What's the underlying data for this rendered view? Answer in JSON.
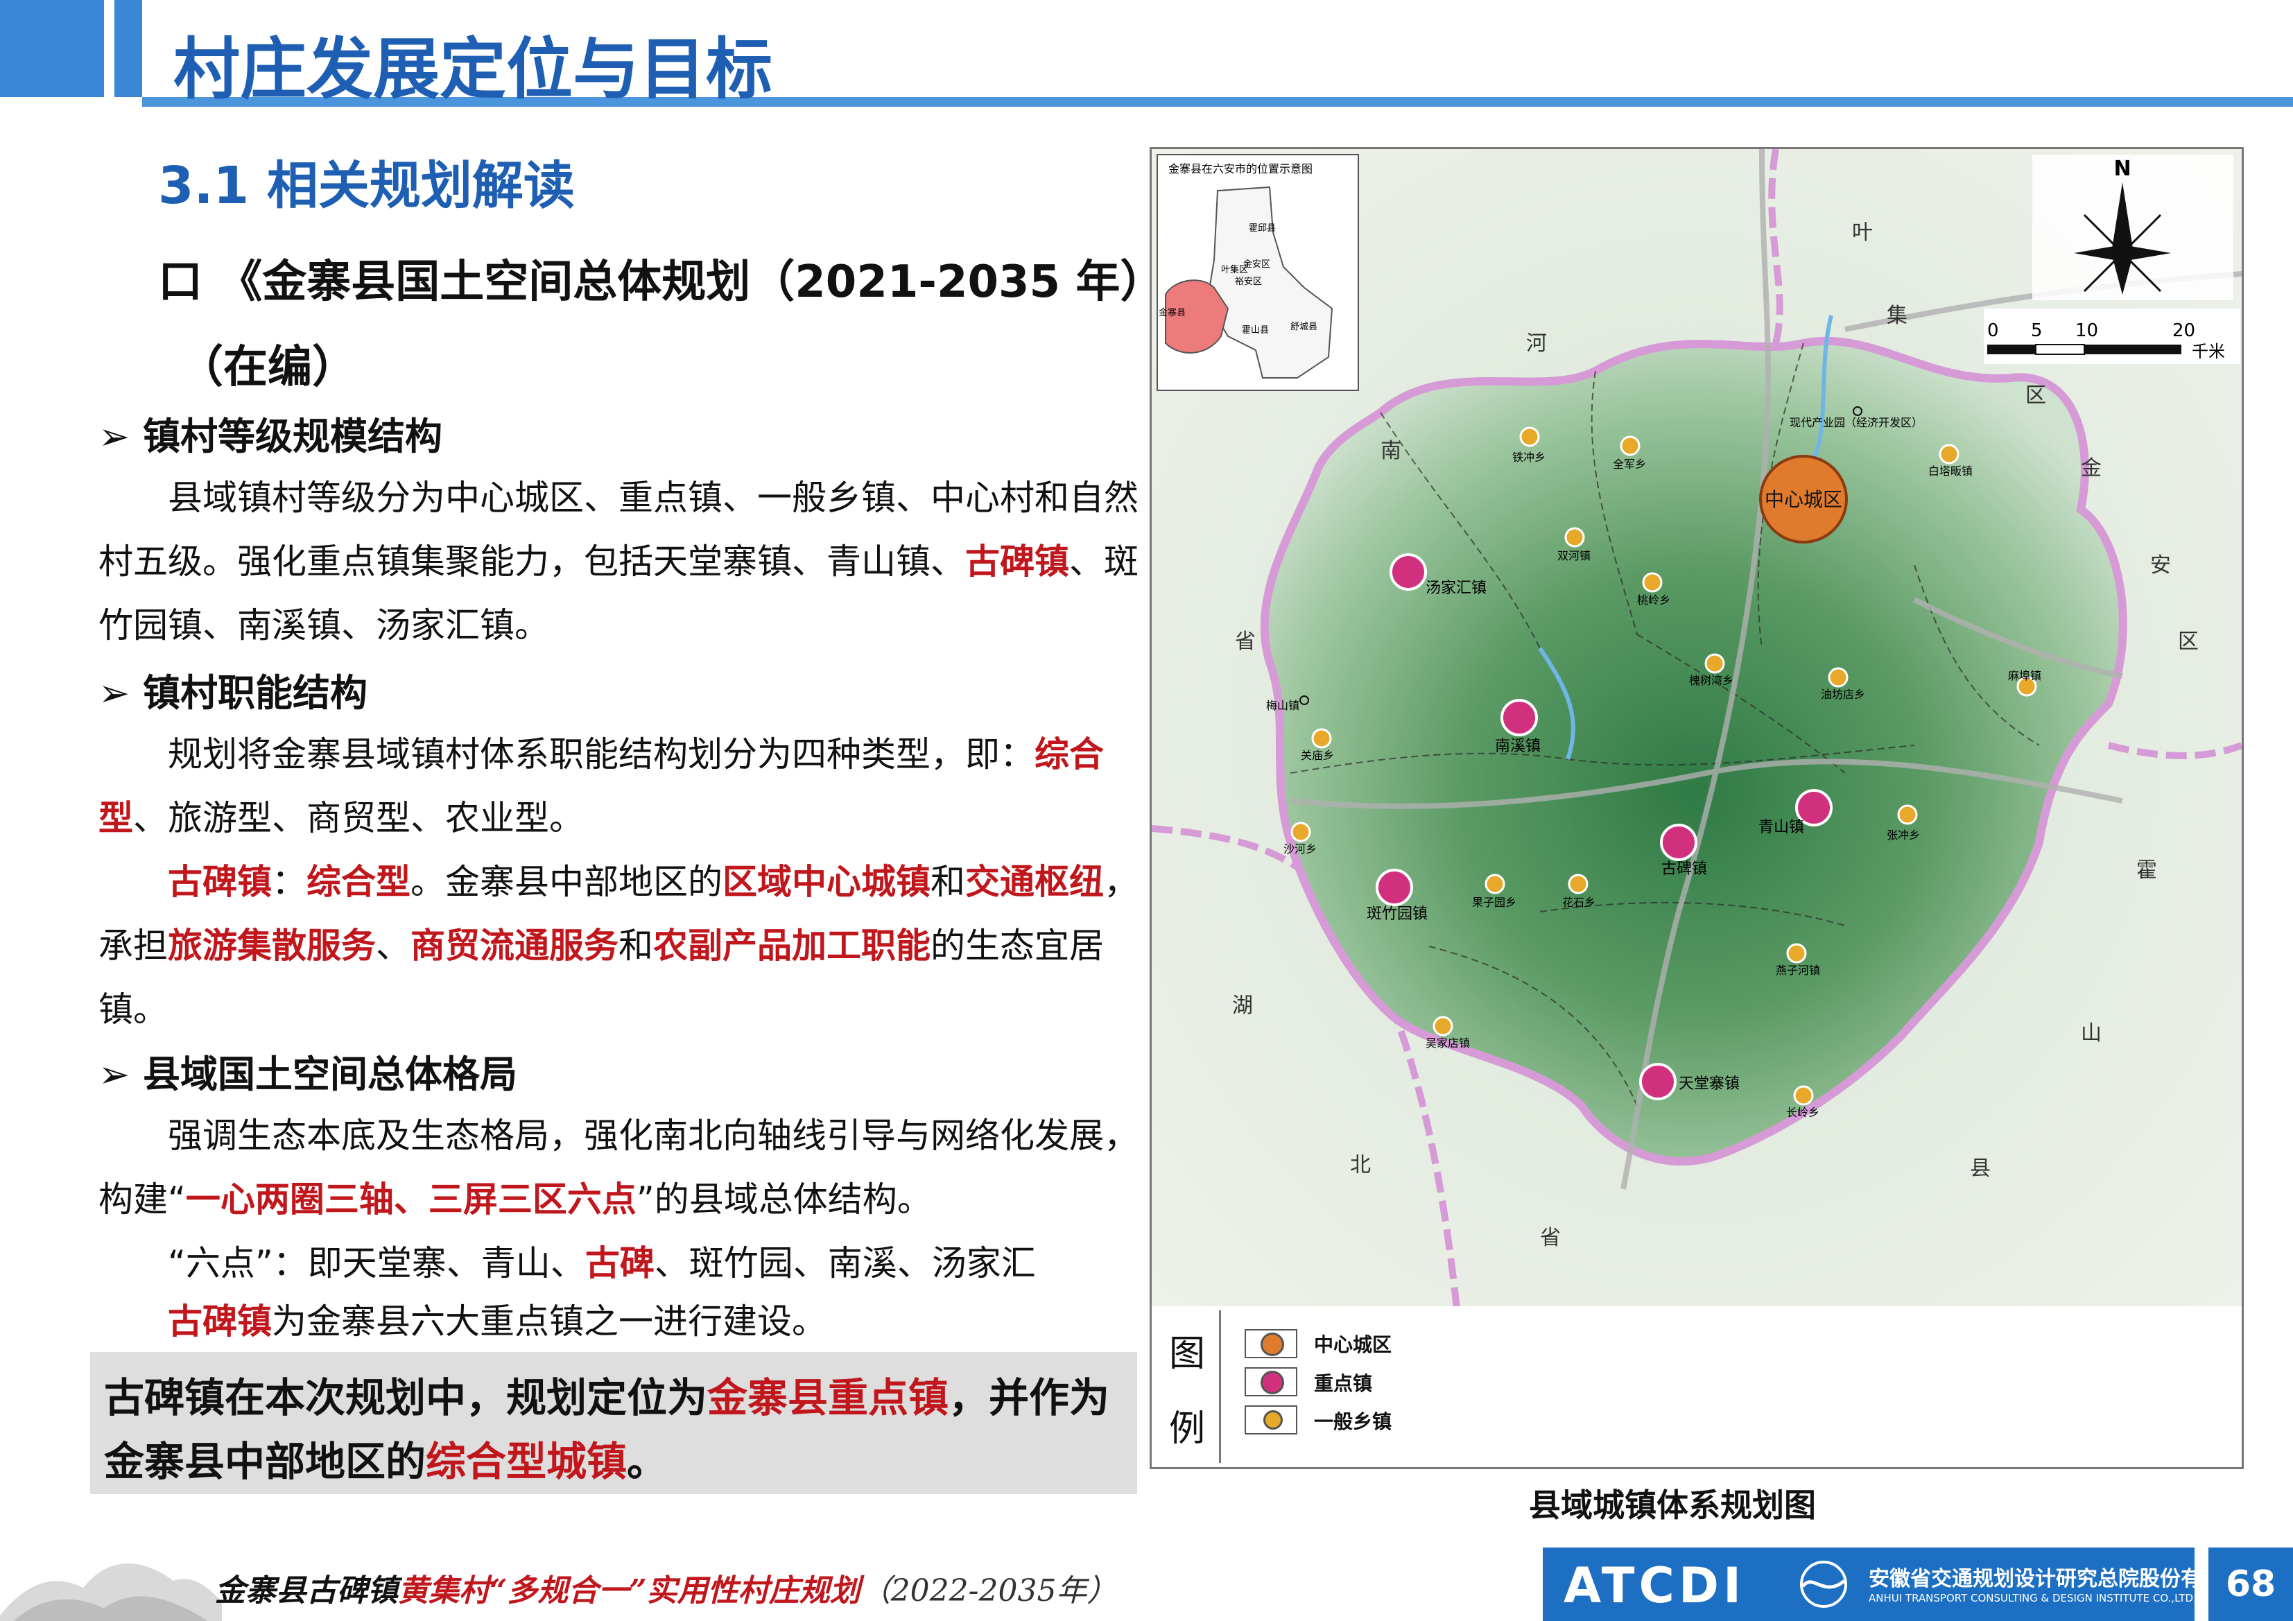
{
  "header": {
    "title": "村庄发展定位与目标"
  },
  "section": {
    "title": "3.1 相关规划解读"
  },
  "doc": {
    "bullet": "口",
    "line1": "《金寨县国土空间总体规划（2021-2035 年）",
    "line2": "（在编）"
  },
  "s1": {
    "heading": "➢ 镇村等级规模结构",
    "p1": "县域镇村等级分为中心城区、重点镇、一般乡镇、中心村和自然村五级。强化重点镇集聚能力，包括天堂寨镇、青山镇、",
    "p1_red": "古碑镇",
    "p1_end": "、斑竹园镇、南溪镇、汤家汇镇。"
  },
  "s2": {
    "heading": "➢ 镇村职能结构",
    "p1": "规划将金寨县域镇村体系职能结构划分为四种类型，即：",
    "p1_red": "综合型",
    "p1_end": "、旅游型、商贸型、农业型。",
    "p2_a_red": "古碑镇",
    "p2_b": "：",
    "p2_c_red": "综合型",
    "p2_d": "。金寨县中部地区的",
    "p2_e_red": "区域中心城镇",
    "p2_f": "和",
    "p2_g_red": "交通枢纽",
    "p2_h": "，承担",
    "p2_i_red": "旅游集散服务",
    "p2_j": "、",
    "p2_k_red": "商贸流通服务",
    "p2_l": "和",
    "p2_m_red": "农副产品加工职能",
    "p2_n": "的生态宜居镇。"
  },
  "s3": {
    "heading": "➢ 县域国土空间总体格局",
    "p1": "强调生态本底及生态格局，强化南北向轴线引导与网络化发展，构建“",
    "p1_red": "一心两圈三轴、三屏三区六点",
    "p1_end": "”的县域总体结构。",
    "p2_a": "“六点”：即天堂寨、青山、",
    "p2_red": "古碑",
    "p2_b": "、斑竹园、南溪、汤家汇",
    "p3_red": "古碑镇",
    "p3_end": "为金寨县六大重点镇之一进行建设。"
  },
  "summary": {
    "a": "古碑镇在本次规划中，规划定位为",
    "b_red": "金寨县重点镇",
    "c": "，并作为金寨县中部地区的",
    "d_red": "综合型城镇",
    "e": "。"
  },
  "map": {
    "inset_title": "金寨县在六安市的位置示意图",
    "inset_labels": [
      "霍邱县",
      "金安区",
      "裕安区",
      "叶集区",
      "舒城县",
      "霍山县",
      "金寨县"
    ],
    "north": "N",
    "scale_ticks": [
      "0",
      "5",
      "10",
      "20"
    ],
    "scale_unit": "千米",
    "neighbor_labels": [
      "叶",
      "集",
      "区",
      "河",
      "南",
      "省",
      "金",
      "安",
      "区",
      "霍",
      "山",
      "县",
      "湖",
      "北",
      "省"
    ],
    "center_label": "中心城区",
    "dev_zone": "现代产业园（经济开发区）",
    "key_towns": [
      "汤家汇镇",
      "南溪镇",
      "斑竹园镇",
      "古碑镇",
      "青山镇",
      "天堂寨镇"
    ],
    "general_towns": [
      "铁冲乡",
      "全军乡",
      "白塔畈镇",
      "双河镇",
      "桃岭乡",
      "槐树湾乡",
      "油坊店乡",
      "麻埠镇",
      "关庙乡",
      "沙河乡",
      "果子园乡",
      "花石乡",
      "张冲乡",
      "燕子河镇",
      "吴家店镇",
      "长岭乡",
      "梅山镇"
    ],
    "colors": {
      "center": "#e07b2e",
      "key": "#d1307f",
      "general": "#e8a92a",
      "boundary": "#d69bd6"
    }
  },
  "legend": {
    "title_top": "图",
    "title_bottom": "例",
    "items": [
      {
        "label": "中心城区"
      },
      {
        "label": "重点镇"
      },
      {
        "label": "一般乡镇"
      }
    ]
  },
  "map_caption": "县域城镇体系规划图",
  "footer": {
    "a": "金寨县古碑镇",
    "b_red": "黄集村“多规合一”实用性村庄规划",
    "c": "（2022-2035年）",
    "logo_text": "ATCDI",
    "company_cn": "安徽省交通规划设计研究总院股份有限公司",
    "company_en": "ANHUI TRANSPORT CONSULTING & DESIGN INSTITUTE CO.,LTD.",
    "page": "68"
  }
}
